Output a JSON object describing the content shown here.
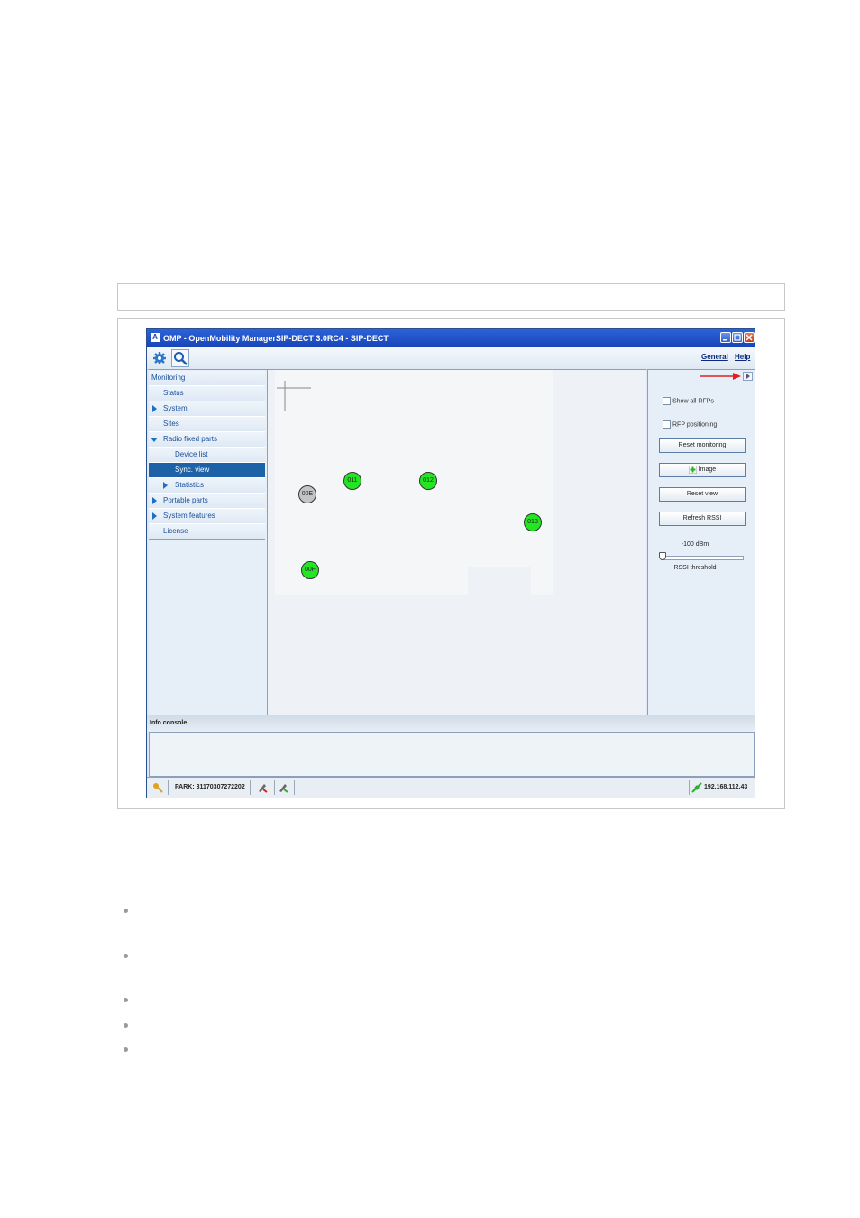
{
  "window": {
    "title": "OMP - OpenMobility ManagerSIP-DECT 3.0RC4 - SIP-DECT",
    "app_icon_glyph": "A"
  },
  "toolbar": {
    "settings_icon": "gear-icon",
    "monitor_icon": "magnifier-icon",
    "menu_general": "General",
    "menu_help": "Help"
  },
  "sidebar": {
    "items": [
      {
        "label": "Monitoring"
      },
      {
        "label": "Status"
      },
      {
        "label": "System"
      },
      {
        "label": "Sites"
      },
      {
        "label": "Radio fixed parts"
      },
      {
        "label": "Device list"
      },
      {
        "label": "Sync. view"
      },
      {
        "label": "Statistics"
      },
      {
        "label": "Portable parts"
      },
      {
        "label": "System features"
      },
      {
        "label": "License"
      }
    ]
  },
  "canvas": {
    "rfps": [
      {
        "label": "00E",
        "state": "grey"
      },
      {
        "label": "011",
        "state": "green"
      },
      {
        "label": "012",
        "state": "green"
      },
      {
        "label": "013",
        "state": "green"
      },
      {
        "label": "00F",
        "state": "green"
      }
    ]
  },
  "right_panel": {
    "show_all_rfps": "Show all RFPs",
    "rfp_positioning": "RFP positioning",
    "reset_monitoring": "Reset monitoring",
    "image": "Image",
    "reset_view": "Reset view",
    "refresh_rssi": "Refresh RSSI",
    "rssi_value": "-100 dBm",
    "rssi_label": "RSSI threshold",
    "rssi_threshold_dbm": -100
  },
  "console": {
    "title": "Info console"
  },
  "statusbar": {
    "park": "PARK: 31170307272202",
    "ip": "192.168.112.43"
  },
  "colors": {
    "titlebar": "#1f4fc6",
    "selection": "#1d62a6",
    "rfp_green": "#22e622",
    "rfp_grey": "#c4c4c4",
    "annotation_arrow": "#e02020"
  }
}
